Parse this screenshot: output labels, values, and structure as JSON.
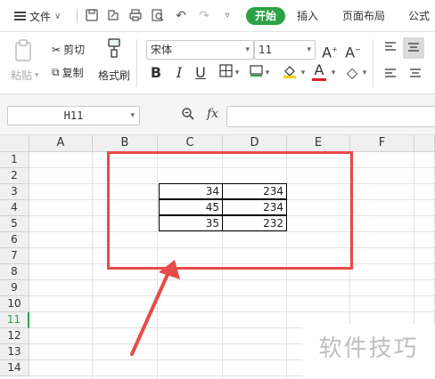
{
  "menu": {
    "file_label": "文件",
    "tabs": [
      "开始",
      "插入",
      "页面布局",
      "公式"
    ],
    "active_tab": "开始"
  },
  "ribbon": {
    "paste_label": "粘贴",
    "cut_label": "剪切",
    "copy_label": "复制",
    "format_painter_label": "格式刷",
    "font_name": "宋体",
    "font_size": "11"
  },
  "formula_bar": {
    "name_box": "H11",
    "fx_label": "fx",
    "formula": ""
  },
  "sheet": {
    "columns": [
      "A",
      "B",
      "C",
      "D",
      "E",
      "F"
    ],
    "rows": [
      "1",
      "2",
      "3",
      "4",
      "5",
      "6",
      "7",
      "8",
      "9",
      "10",
      "11",
      "12",
      "13",
      "14"
    ],
    "active_row": "11",
    "table": [
      [
        "34",
        "234"
      ],
      [
        "45",
        "234"
      ],
      [
        "35",
        "232"
      ]
    ]
  },
  "annotation": {
    "highlight_color": "#e84a4a"
  },
  "watermark": "软件技巧",
  "colors": {
    "accent": "#2ba245",
    "highlight": "#e84a4a"
  }
}
